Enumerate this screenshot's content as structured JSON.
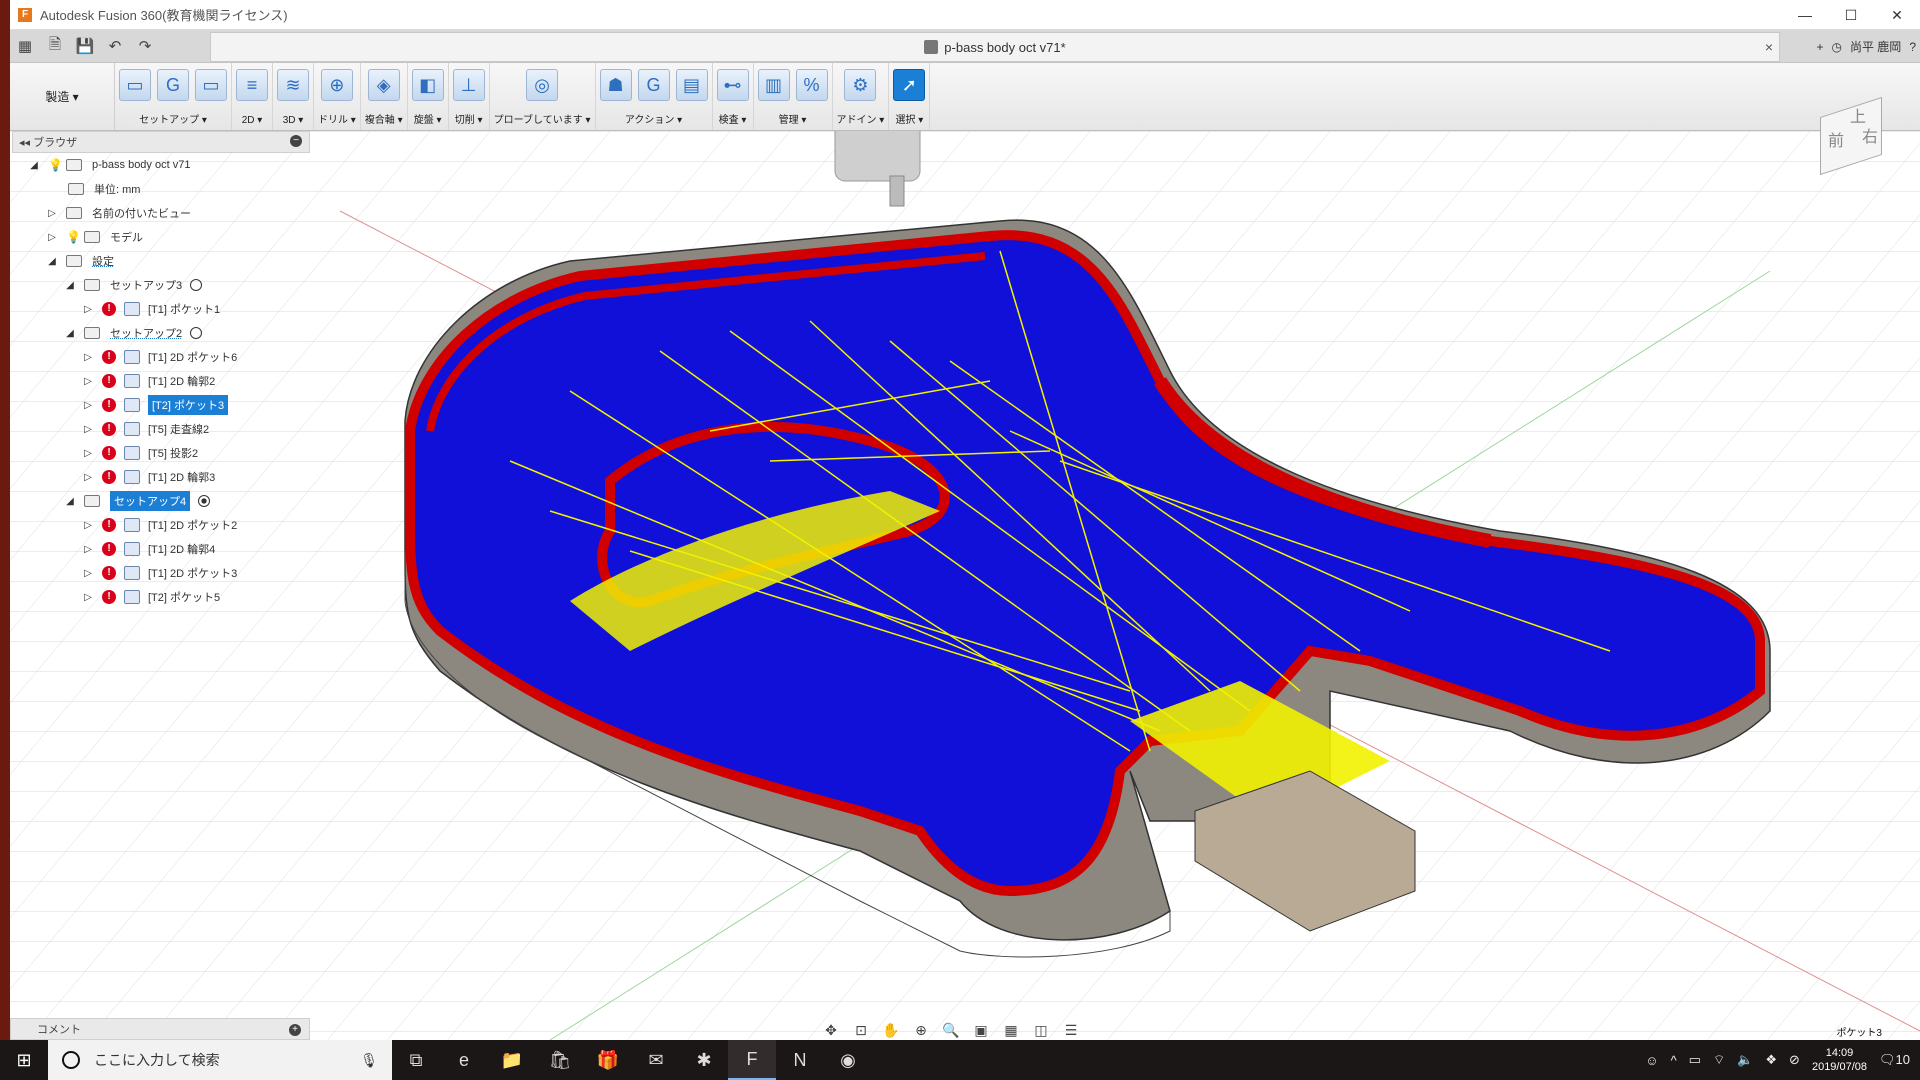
{
  "window": {
    "title": "Autodesk Fusion 360(教育機関ライセンス)",
    "minimize_icon": "minimize-icon",
    "maximize_icon": "maximize-icon",
    "close_icon": "close-icon"
  },
  "quickbar": {
    "document_title": "p-bass body oct v71*",
    "user_name": "尚平 鹿岡",
    "close_label": "×",
    "plus_label": "+"
  },
  "ribbon": {
    "workspace_label": "製造",
    "groups": [
      {
        "label": "セットアップ ▾"
      },
      {
        "label": "2D ▾"
      },
      {
        "label": "3D ▾"
      },
      {
        "label": "ドリル ▾"
      },
      {
        "label": "複合軸 ▾"
      },
      {
        "label": "旋盤 ▾"
      },
      {
        "label": "切削 ▾"
      },
      {
        "label": "プローブしています ▾"
      },
      {
        "label": "アクション ▾"
      },
      {
        "label": "検査 ▾"
      },
      {
        "label": "管理 ▾"
      },
      {
        "label": "アドイン ▾"
      },
      {
        "label": "選択 ▾"
      }
    ]
  },
  "browser": {
    "title": "ブラウザ",
    "root": "p-bass body oct v71",
    "units": "単位: mm",
    "named_views": "名前の付いたビュー",
    "model": "モデル",
    "setups": "設定",
    "setup3": "セットアップ3",
    "pocket1": "[T1] ポケット1",
    "setup2": "セットアップ2",
    "s2_items": [
      "[T1] 2D ポケット6",
      "[T1] 2D 輪郭2",
      "[T2] ポケット3",
      "[T5] 走査線2",
      "[T5] 投影2",
      "[T1] 2D 輪郭3"
    ],
    "setup4": "セットアップ4",
    "s4_items": [
      "[T1] 2D ポケット2",
      "[T1] 2D 輪郭4",
      "[T1] 2D ポケット3",
      "[T2] ポケット5"
    ]
  },
  "viewcube": {
    "front": "前",
    "right": "右",
    "top": "上"
  },
  "comment_panel": {
    "label": "コメント"
  },
  "status": {
    "selection": "ポケット3"
  },
  "taskbar": {
    "search_placeholder": "ここに入力して検索",
    "time": "14:09",
    "date": "2019/07/08",
    "notifications": "10"
  },
  "colors": {
    "toolpath_red": "#d10000",
    "toolpath_blue": "#1010d8",
    "toolpath_yellow": "#f2f200",
    "stock_grey": "#8c8880",
    "accent": "#1c7fd6"
  }
}
